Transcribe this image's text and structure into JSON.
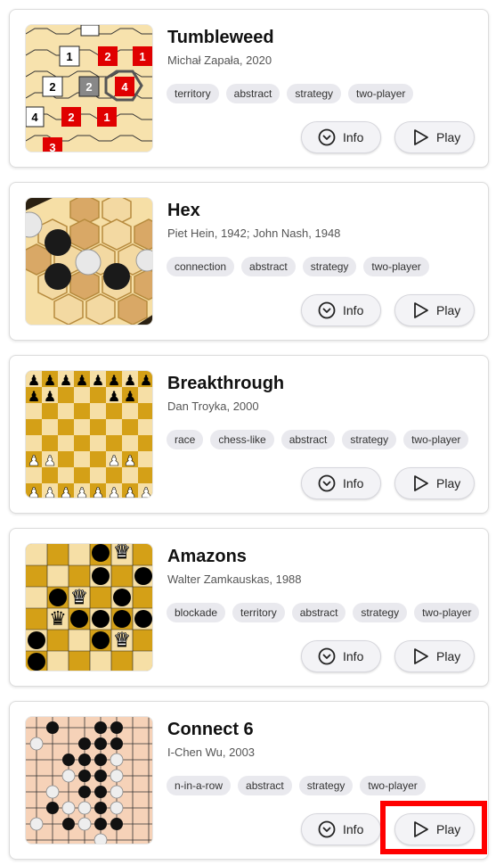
{
  "labels": {
    "info": "Info",
    "play": "Play"
  },
  "games": [
    {
      "title": "Tumbleweed",
      "subtitle": "Michał Zapała, 2020",
      "tags": [
        "territory",
        "abstract",
        "strategy",
        "two-player"
      ],
      "cells": [
        "1",
        "2",
        "1",
        "2",
        "2",
        "4",
        "4",
        "2",
        "1",
        "3"
      ]
    },
    {
      "title": "Hex",
      "subtitle": "Piet Hein, 1942; John Nash, 1948",
      "tags": [
        "connection",
        "abstract",
        "strategy",
        "two-player"
      ]
    },
    {
      "title": "Breakthrough",
      "subtitle": "Dan Troyka, 2000",
      "tags": [
        "race",
        "chess-like",
        "abstract",
        "strategy",
        "two-player"
      ]
    },
    {
      "title": "Amazons",
      "subtitle": "Walter Zamkauskas, 1988",
      "tags": [
        "blockade",
        "territory",
        "abstract",
        "strategy",
        "two-player"
      ]
    },
    {
      "title": "Connect 6",
      "subtitle": "I-Chen Wu, 2003",
      "tags": [
        "n-in-a-row",
        "abstract",
        "strategy",
        "two-player"
      ]
    }
  ],
  "colors": {
    "accent_highlight": "#ff0000",
    "tag_bg": "#e9e9ee",
    "red_stack": "#e00000",
    "board_light": "#f6dfa6",
    "board_dark": "#d4a017"
  }
}
